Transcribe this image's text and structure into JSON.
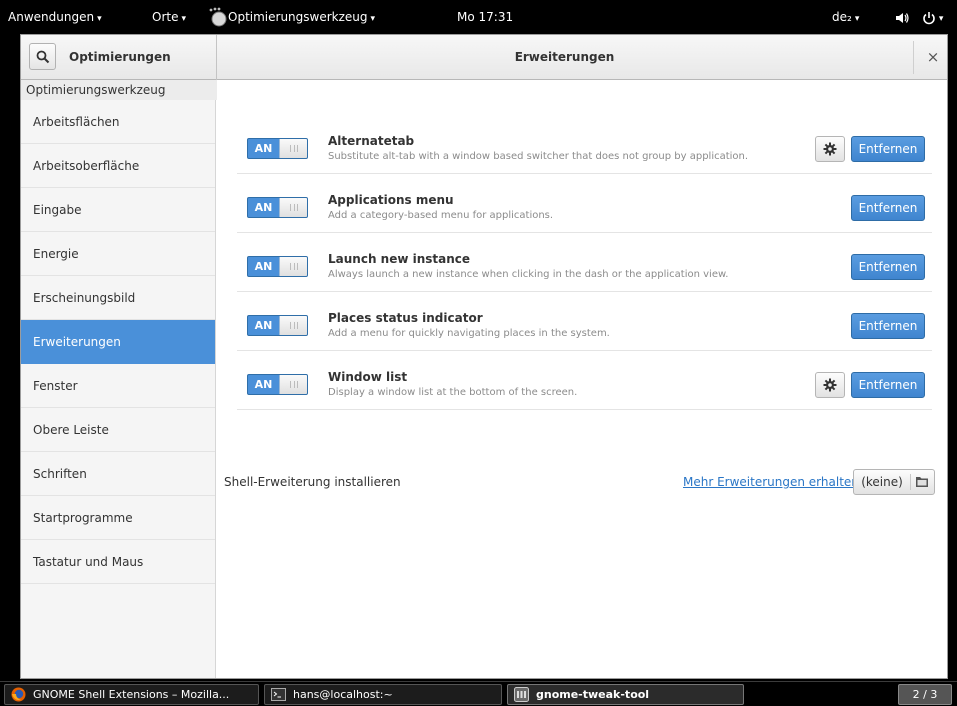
{
  "topbar": {
    "applications": "Anwendungen",
    "places": "Orte",
    "app_menu": "Optimierungswerkzeug",
    "clock": "Mo 17:31",
    "keyboard_layout": "de₂",
    "icons": [
      "volume-icon",
      "power-icon"
    ]
  },
  "header": {
    "sidebar_title": "Optimierungen",
    "main_title": "Erweiterungen",
    "close_glyph": "×"
  },
  "sidebar": {
    "app_label": "Optimierungswerkzeug",
    "selected": "Erweiterungen",
    "items": [
      "Arbeitsflächen",
      "Arbeitsoberfläche",
      "Eingabe",
      "Energie",
      "Erscheinungsbild",
      "Erweiterungen",
      "Fenster",
      "Obere Leiste",
      "Schriften",
      "Startprogramme",
      "Tastatur und Maus"
    ]
  },
  "extensions": {
    "switch_on_label": "AN",
    "remove_label": "Entfernen",
    "items": [
      {
        "name": "Alternatetab",
        "desc": "Substitute alt-tab with a window based switcher that does not group by application.",
        "enabled": true,
        "has_settings": true
      },
      {
        "name": "Applications menu",
        "desc": "Add a category-based menu for applications.",
        "enabled": true,
        "has_settings": false
      },
      {
        "name": "Launch new instance",
        "desc": "Always launch a new instance when clicking in the dash or the application view.",
        "enabled": true,
        "has_settings": false
      },
      {
        "name": "Places status indicator",
        "desc": "Add a menu for quickly navigating places in the system.",
        "enabled": true,
        "has_settings": false
      },
      {
        "name": "Window list",
        "desc": "Display a window list at the bottom of the screen.",
        "enabled": true,
        "has_settings": true
      }
    ]
  },
  "install": {
    "label": "Shell-Erweiterung installieren",
    "more_link": "Mehr Erweiterungen erhalten",
    "file_button": "(keine)"
  },
  "taskbar": {
    "tasks": [
      {
        "label": "GNOME Shell Extensions – Mozilla...",
        "icon": "firefox-icon"
      },
      {
        "label": "hans@localhost:~",
        "icon": "terminal-icon"
      },
      {
        "label": "gnome-tweak-tool",
        "icon": "tweak-tool-icon"
      }
    ],
    "workspace": "2 / 3"
  },
  "colors": {
    "accent": "#4a90d9",
    "link": "#2a76c6"
  }
}
